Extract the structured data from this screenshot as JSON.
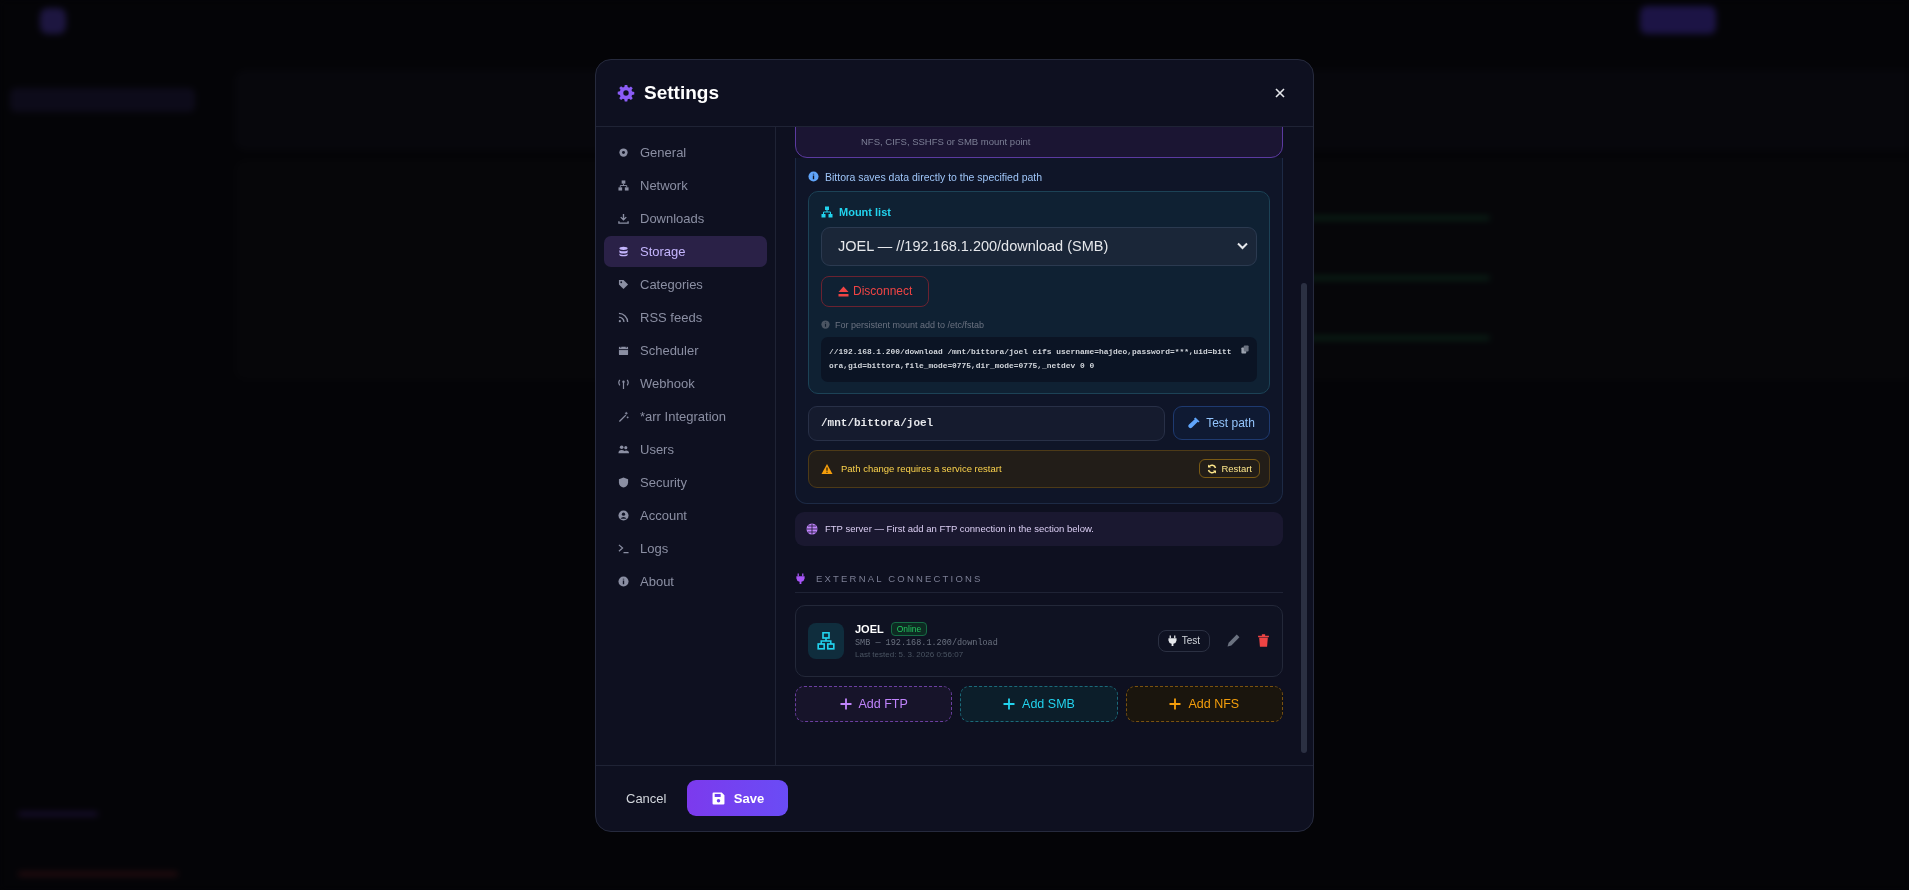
{
  "modal": {
    "title": "Settings"
  },
  "sidebar": {
    "items": [
      {
        "label": "General",
        "selected": false
      },
      {
        "label": "Network",
        "selected": false
      },
      {
        "label": "Downloads",
        "selected": false
      },
      {
        "label": "Storage",
        "selected": true
      },
      {
        "label": "Categories",
        "selected": false
      },
      {
        "label": "RSS feeds",
        "selected": false
      },
      {
        "label": "Scheduler",
        "selected": false
      },
      {
        "label": "Webhook",
        "selected": false
      },
      {
        "label": "*arr Integration",
        "selected": false
      },
      {
        "label": "Users",
        "selected": false
      },
      {
        "label": "Security",
        "selected": false
      },
      {
        "label": "Account",
        "selected": false
      },
      {
        "label": "Logs",
        "selected": false
      },
      {
        "label": "About",
        "selected": false
      }
    ]
  },
  "storage_option": {
    "subtitle": "NFS, CIFS, SSHFS or SMB mount point"
  },
  "storage_info": "Bittora saves data directly to the specified path",
  "mount_list": {
    "title": "Mount list",
    "selected_mount": "JOEL — //192.168.1.200/download (SMB)",
    "disconnect_button": "Disconnect",
    "hint": "For persistent mount add to /etc/fstab",
    "fstab_line": "//192.168.1.200/download /mnt/bittora/joel cifs username=hajdeo,password=***,uid=bittora,gid=bittora,file_mode=0775,dir_mode=0775,_netdev 0 0"
  },
  "path": {
    "value": "/mnt/bittora/joel",
    "test_button": "Test path"
  },
  "warning": {
    "text": "Path change requires a service restart",
    "restart_button": "Restart"
  },
  "ftp_notice": "FTP server — First add an FTP connection in the section below.",
  "external_connections": {
    "title": "EXTERNAL CONNECTIONS",
    "connections": [
      {
        "name": "JOEL",
        "status": "Online",
        "online": true,
        "detail": "SMB — 192.168.1.200/download",
        "last_tested": "Last tested: 5. 3. 2026 0:56:07",
        "test_button": "Test"
      }
    ],
    "add_buttons": [
      {
        "label": "Add FTP",
        "kind": "ftp"
      },
      {
        "label": "Add SMB",
        "kind": "smb"
      },
      {
        "label": "Add NFS",
        "kind": "nfs"
      }
    ]
  },
  "footer": {
    "cancel": "Cancel",
    "save": "Save"
  }
}
